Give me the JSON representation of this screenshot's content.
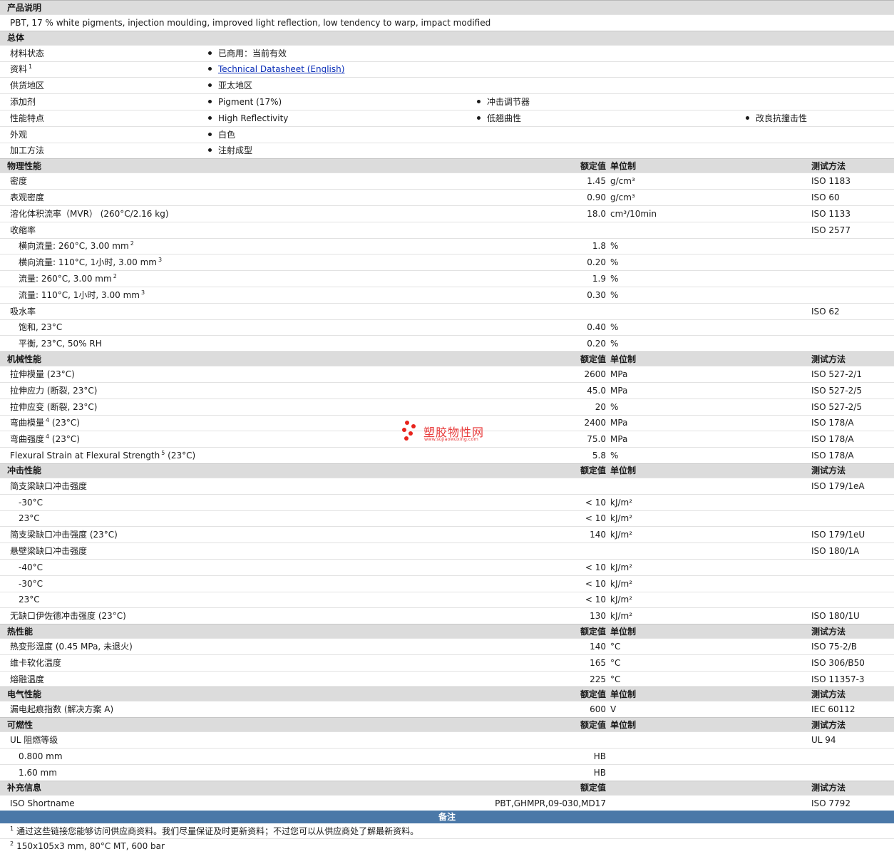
{
  "product": {
    "heading": "产品说明",
    "description": "PBT, 17 % white pigments, injection moulding, improved light reflection, low tendency to warp, impact modified"
  },
  "general": {
    "heading": "总体",
    "rows": [
      {
        "label": "材料状态",
        "items": [
          "已商用：当前有效"
        ]
      },
      {
        "label": "资料",
        "sup": "1",
        "items": [
          "Technical Datasheet (English)"
        ],
        "link": true
      },
      {
        "label": "供货地区",
        "items": [
          "亚太地区"
        ]
      },
      {
        "label": "添加剂",
        "items": [
          "Pigment (17%)",
          "冲击调节器"
        ]
      },
      {
        "label": "性能特点",
        "items": [
          "High Reflectivity",
          "低翘曲性",
          "改良抗撞击性"
        ]
      },
      {
        "label": "外观",
        "items": [
          "白色"
        ]
      },
      {
        "label": "加工方法",
        "items": [
          "注射成型"
        ]
      }
    ]
  },
  "header_labels": {
    "rated": "额定值",
    "unit": "单位制",
    "method": "测试方法"
  },
  "sections": [
    {
      "title": "物理性能",
      "show_unit": true,
      "rows": [
        {
          "label": "密度",
          "value": "1.45",
          "unit": "g/cm³",
          "method": "ISO 1183"
        },
        {
          "label": "表观密度",
          "value": "0.90",
          "unit": "g/cm³",
          "method": "ISO 60"
        },
        {
          "label": "溶化体积流率（MVR） (260°C/2.16 kg)",
          "value": "18.0",
          "unit": "cm³/10min",
          "method": "ISO 1133"
        },
        {
          "label": "收缩率",
          "value": "",
          "unit": "",
          "method": "ISO 2577"
        },
        {
          "label": "横向流量: 260°C, 3.00 mm",
          "sup": "2",
          "indent": true,
          "value": "1.8",
          "unit": "%",
          "method": ""
        },
        {
          "label": "横向流量: 110°C, 1小时, 3.00 mm",
          "sup": "3",
          "indent": true,
          "value": "0.20",
          "unit": "%",
          "method": ""
        },
        {
          "label": "流量: 260°C, 3.00 mm",
          "sup": "2",
          "indent": true,
          "value": "1.9",
          "unit": "%",
          "method": ""
        },
        {
          "label": "流量: 110°C, 1小时, 3.00 mm",
          "sup": "3",
          "indent": true,
          "value": "0.30",
          "unit": "%",
          "method": ""
        },
        {
          "label": "吸水率",
          "value": "",
          "unit": "",
          "method": "ISO 62"
        },
        {
          "label": "饱和, 23°C",
          "indent": true,
          "value": "0.40",
          "unit": "%",
          "method": ""
        },
        {
          "label": "平衡, 23°C, 50% RH",
          "indent": true,
          "value": "0.20",
          "unit": "%",
          "method": ""
        }
      ]
    },
    {
      "title": "机械性能",
      "show_unit": true,
      "rows": [
        {
          "label": "拉伸模量 (23°C)",
          "value": "2600",
          "unit": "MPa",
          "method": "ISO 527-2/1"
        },
        {
          "label": "拉伸应力 (断裂, 23°C)",
          "value": "45.0",
          "unit": "MPa",
          "method": "ISO 527-2/5"
        },
        {
          "label": "拉伸应变 (断裂, 23°C)",
          "value": "20",
          "unit": "%",
          "method": "ISO 527-2/5"
        },
        {
          "label": "弯曲模量",
          "sup": "4",
          "suffix": " (23°C)",
          "value": "2400",
          "unit": "MPa",
          "method": "ISO 178/A"
        },
        {
          "label": "弯曲强度",
          "sup": "4",
          "suffix": " (23°C)",
          "value": "75.0",
          "unit": "MPa",
          "method": "ISO 178/A"
        },
        {
          "label": "Flexural Strain at Flexural Strength",
          "sup": "5",
          "suffix": " (23°C)",
          "value": "5.8",
          "unit": "%",
          "method": "ISO 178/A"
        }
      ]
    },
    {
      "title": "冲击性能",
      "show_unit": true,
      "rows": [
        {
          "label": "简支梁缺口冲击强度",
          "value": "",
          "unit": "",
          "method": "ISO 179/1eA"
        },
        {
          "label": "-30°C",
          "indent": true,
          "value": "< 10",
          "unit": "kJ/m²",
          "method": ""
        },
        {
          "label": "23°C",
          "indent": true,
          "value": "< 10",
          "unit": "kJ/m²",
          "method": ""
        },
        {
          "label": "简支梁缺口冲击强度 (23°C)",
          "value": "140",
          "unit": "kJ/m²",
          "method": "ISO 179/1eU"
        },
        {
          "label": "悬壁梁缺口冲击强度",
          "value": "",
          "unit": "",
          "method": "ISO 180/1A"
        },
        {
          "label": "-40°C",
          "indent": true,
          "value": "< 10",
          "unit": "kJ/m²",
          "method": ""
        },
        {
          "label": "-30°C",
          "indent": true,
          "value": "< 10",
          "unit": "kJ/m²",
          "method": ""
        },
        {
          "label": "23°C",
          "indent": true,
          "value": "< 10",
          "unit": "kJ/m²",
          "method": ""
        },
        {
          "label": "无缺口伊佐德冲击强度 (23°C)",
          "value": "130",
          "unit": "kJ/m²",
          "method": "ISO 180/1U"
        }
      ]
    },
    {
      "title": "热性能",
      "show_unit": true,
      "rows": [
        {
          "label": "热变形温度 (0.45 MPa, 未退火)",
          "value": "140",
          "unit": "°C",
          "method": "ISO 75-2/B"
        },
        {
          "label": "维卡软化温度",
          "value": "165",
          "unit": "°C",
          "method": "ISO 306/B50"
        },
        {
          "label": "熔融温度",
          "value": "225",
          "unit": "°C",
          "method": "ISO 11357-3"
        }
      ]
    },
    {
      "title": "电气性能",
      "show_unit": true,
      "rows": [
        {
          "label": "漏电起痕指数 (解决方案 A)",
          "value": "600",
          "unit": "V",
          "method": "IEC 60112"
        }
      ]
    },
    {
      "title": "可燃性",
      "show_unit": true,
      "rows": [
        {
          "label": "UL 阻燃等级",
          "value": "",
          "unit": "",
          "method": "UL 94"
        },
        {
          "label": "0.800 mm",
          "indent": true,
          "value": "HB",
          "unit": "",
          "method": ""
        },
        {
          "label": "1.60 mm",
          "indent": true,
          "value": "HB",
          "unit": "",
          "method": ""
        }
      ]
    },
    {
      "title": "补充信息",
      "show_unit": false,
      "rows": [
        {
          "label": "ISO Shortname",
          "value": "PBT,GHMPR,09-030,MD17",
          "unit": "",
          "method": "ISO 7792"
        }
      ]
    }
  ],
  "notes": {
    "title": "备注",
    "items": [
      {
        "num": "1",
        "text": "通过这些链接您能够访问供应商资料。我们尽量保证及时更新资料；不过您可以从供应商处了解最新资料。"
      },
      {
        "num": "2",
        "text": "150x105x3 mm, 80°C MT, 600 bar"
      }
    ]
  },
  "watermark": {
    "name": "塑胶物性网",
    "url": "www.sujiaowuxing.com",
    "color": "#e8231c"
  }
}
